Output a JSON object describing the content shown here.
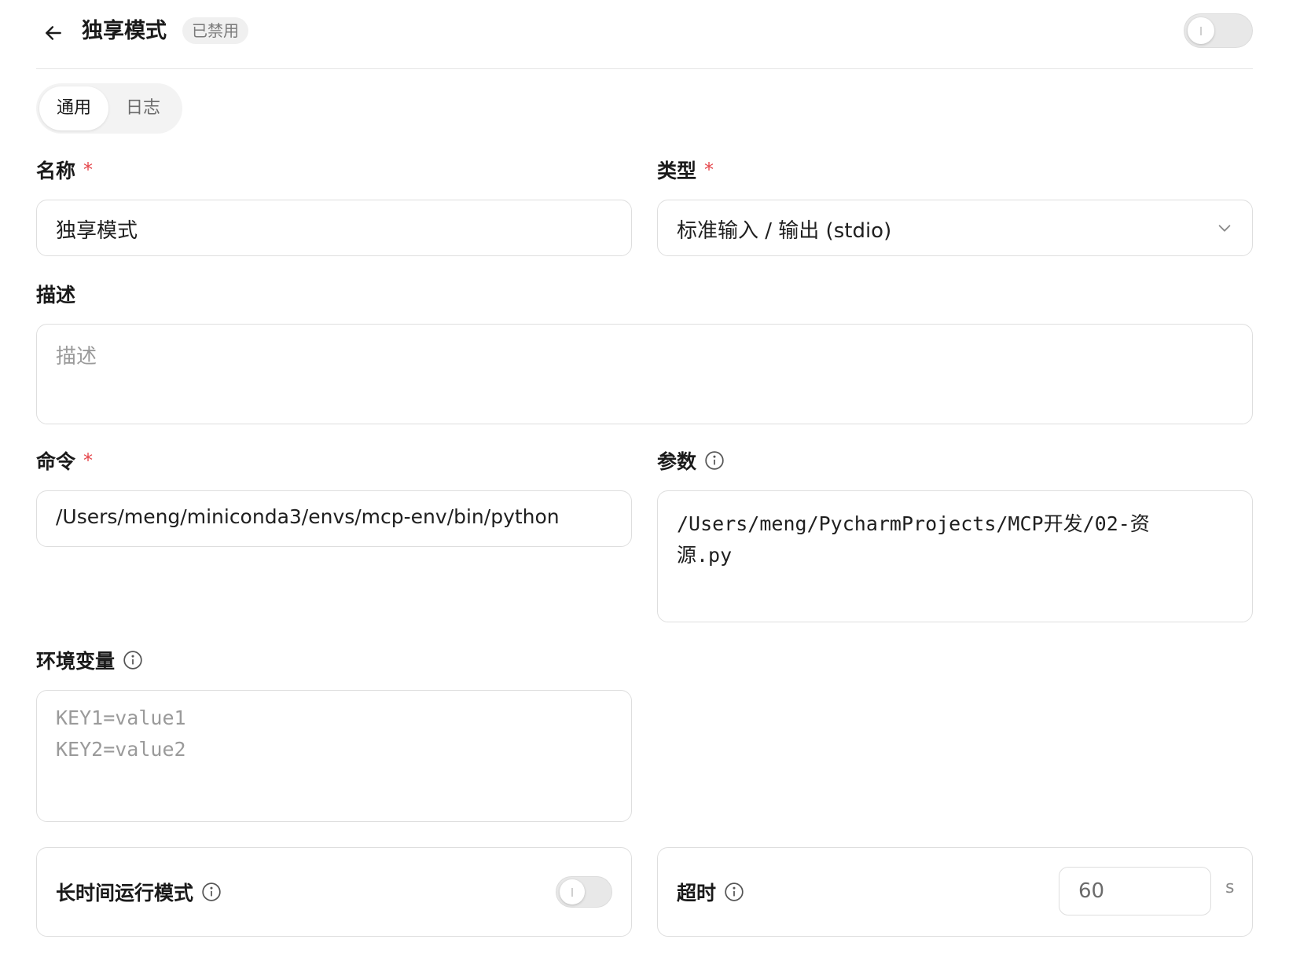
{
  "header": {
    "title": "独享模式",
    "status_badge": "已禁用"
  },
  "tabs": [
    {
      "label": "通用",
      "active": true
    },
    {
      "label": "日志",
      "active": false
    }
  ],
  "form": {
    "name": {
      "label": "名称",
      "required_mark": "*",
      "value": "独享模式"
    },
    "type": {
      "label": "类型",
      "required_mark": "*",
      "value": "标准输入 / 输出 (stdio)"
    },
    "description": {
      "label": "描述",
      "placeholder": "描述"
    },
    "command": {
      "label": "命令",
      "required_mark": "*",
      "value": "/Users/meng/miniconda3/envs/mcp-env/bin/python"
    },
    "args": {
      "label": "参数",
      "value_line1": "/Users/meng/PycharmProjects/MCP开发/02-资",
      "value_line2": "源.py"
    },
    "env": {
      "label": "环境变量",
      "placeholder_line1": "KEY1=value1",
      "placeholder_line2": "KEY2=value2"
    },
    "long_running": {
      "label": "长时间运行模式",
      "enabled": false
    },
    "timeout": {
      "label": "超时",
      "value": "60",
      "unit": "s"
    }
  },
  "colors": {
    "required": "#e5484d",
    "border": "#dedede",
    "badge_bg": "#f0f0f0"
  }
}
